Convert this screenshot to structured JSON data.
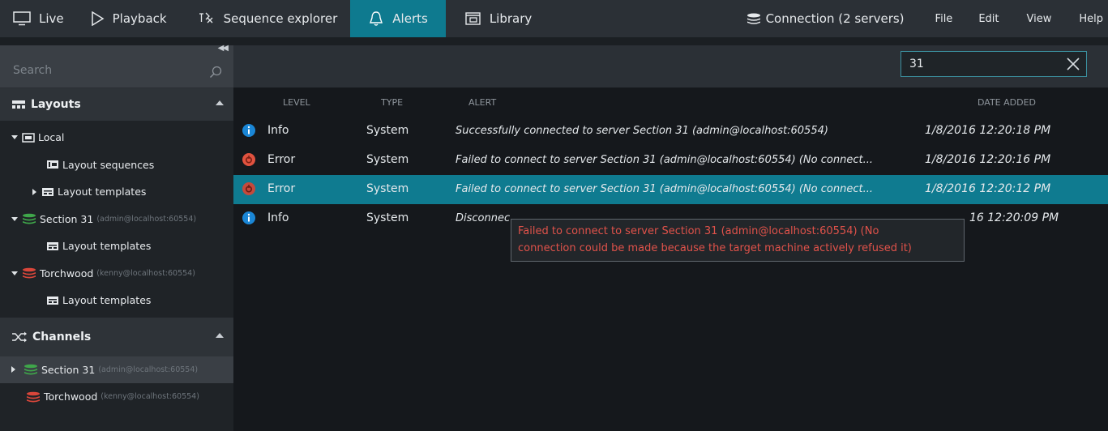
{
  "topbar": {
    "tabs": [
      {
        "label": "Live",
        "icon": "monitor-icon"
      },
      {
        "label": "Playback",
        "icon": "play-icon"
      },
      {
        "label": "Sequence explorer",
        "icon": "sequence-icon"
      },
      {
        "label": "Alerts",
        "icon": "bell-icon",
        "active": true
      },
      {
        "label": "Library",
        "icon": "library-icon"
      }
    ],
    "connection_label": "Connection (2 servers)",
    "menu": [
      "File",
      "Edit",
      "View",
      "Help"
    ],
    "accent_color": "#0e7a8f"
  },
  "sidebar": {
    "search_placeholder": "Search",
    "layouts": {
      "title": "Layouts",
      "items": [
        {
          "label": "Local",
          "sub": ""
        },
        {
          "label": "Layout sequences",
          "sub": ""
        },
        {
          "label": "Layout templates",
          "sub": ""
        },
        {
          "label": "Section 31",
          "sub": "(admin@localhost:60554)"
        },
        {
          "label": "Layout templates",
          "sub": ""
        },
        {
          "label": "Torchwood",
          "sub": "(kenny@localhost:60554)"
        },
        {
          "label": "Layout templates",
          "sub": ""
        }
      ]
    },
    "channels": {
      "title": "Channels",
      "items": [
        {
          "label": "Section 31",
          "sub": "(admin@localhost:60554)"
        },
        {
          "label": "Torchwood",
          "sub": "(kenny@localhost:60554)"
        }
      ]
    }
  },
  "main": {
    "filter_value": "31",
    "columns": {
      "level": "LEVEL",
      "type": "TYPE",
      "alert": "ALERT",
      "date": "DATE ADDED"
    },
    "rows": [
      {
        "level": "Info",
        "type": "System",
        "alert": "Successfully connected to server Section 31 (admin@localhost:60554)",
        "date": "1/8/2016 12:20:18 PM"
      },
      {
        "level": "Error",
        "type": "System",
        "alert": "Failed to connect to server Section 31 (admin@localhost:60554) (No connect...",
        "date": "1/8/2016 12:20:16 PM"
      },
      {
        "level": "Error",
        "type": "System",
        "alert": "Failed to connect to server Section 31 (admin@localhost:60554) (No connect...",
        "date": "1/8/2016 12:20:12 PM"
      },
      {
        "level": "Info",
        "type": "System",
        "alert": "Disconnec",
        "date": "16 12:20:09 PM"
      }
    ],
    "tooltip": {
      "line1": "Failed to connect to server Section 31 (admin@localhost:60554) (No",
      "line2": "connection could be made because the target machine actively refused it)"
    }
  }
}
